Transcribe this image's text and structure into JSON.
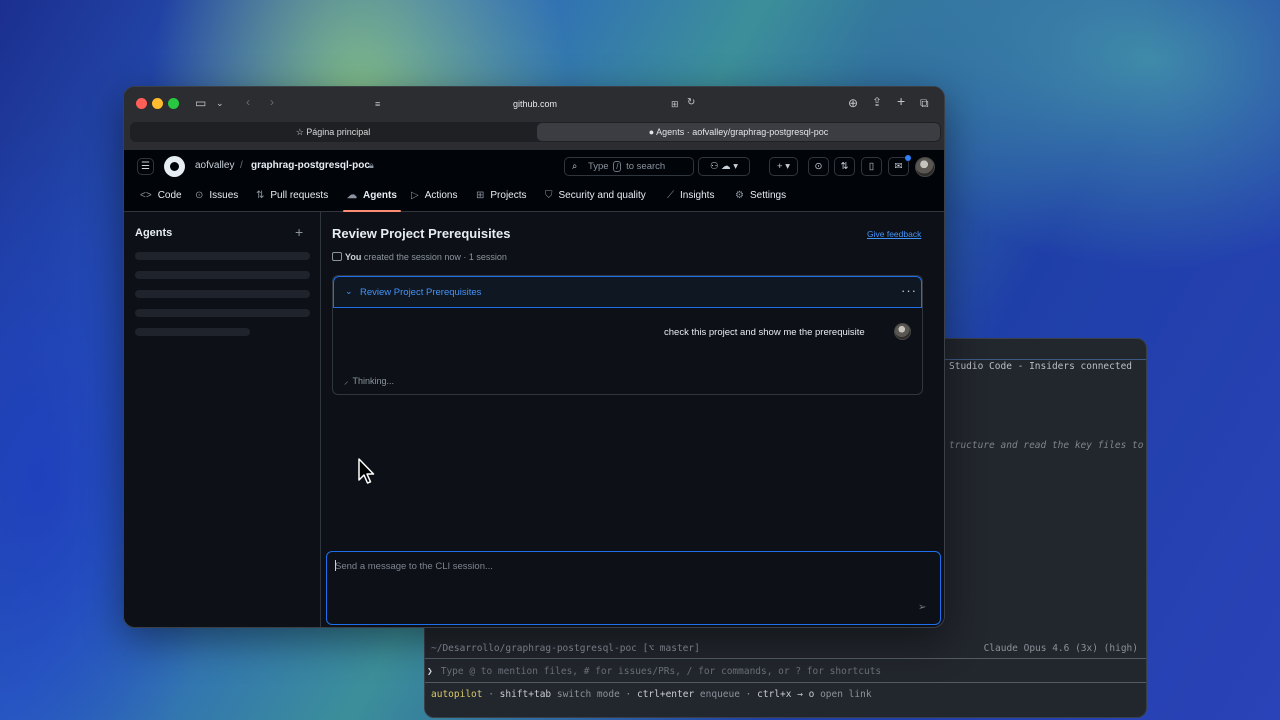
{
  "terminal": {
    "line1": "Studio Code - Insiders connected",
    "line2": "tructure and read the key files to",
    "path": "~/Desarrollo/graphrag-postgresql-poc [⌥ master]",
    "model": "Claude Opus 4.6 (3x) (high)",
    "prompt_symbol": "❯",
    "prompt_hint": "Type @ to mention files, # for issues/PRs, / for commands, or ? for shortcuts",
    "mode": "autopilot",
    "hints": [
      {
        "key": "shift+tab",
        "text": "switch mode"
      },
      {
        "key": "ctrl+enter",
        "text": "enqueue"
      },
      {
        "key": "ctrl+x → o",
        "text": "open link"
      }
    ]
  },
  "browser": {
    "url": "github.com",
    "tabs": [
      {
        "label": "Página principal",
        "icon": "star-icon"
      },
      {
        "label": "Agents · aofvalley/graphrag-postgresql-poc",
        "icon": "github-icon"
      }
    ]
  },
  "github": {
    "owner": "aofvalley",
    "separator": "/",
    "repo": "graphrag-postgresql-poc",
    "search": {
      "prefix": "Type",
      "key": "/",
      "suffix": "to search"
    },
    "nav": [
      {
        "label": "Code",
        "icon": "<>"
      },
      {
        "label": "Issues",
        "icon": "⊙"
      },
      {
        "label": "Pull requests",
        "icon": "⇅"
      },
      {
        "label": "Agents",
        "icon": "☁"
      },
      {
        "label": "Actions",
        "icon": "▷"
      },
      {
        "label": "Projects",
        "icon": "⊞"
      },
      {
        "label": "Security and quality",
        "icon": "⛉"
      },
      {
        "label": "Insights",
        "icon": "⟋"
      },
      {
        "label": "Settings",
        "icon": "⚙"
      }
    ],
    "active_tab": "Agents",
    "accent": "#fd8c73"
  },
  "sidebar": {
    "title": "Agents",
    "add": "+"
  },
  "main": {
    "title": "Review Project Prerequisites",
    "feedback": "Give feedback",
    "meta_user": "You",
    "meta_text": "created the session now · 1 session",
    "session": {
      "title": "Review Project Prerequisites",
      "user_message": "check this project and show me the prerequisite",
      "status": "Thinking..."
    },
    "composer_placeholder": "Send a message to the CLI session..."
  }
}
